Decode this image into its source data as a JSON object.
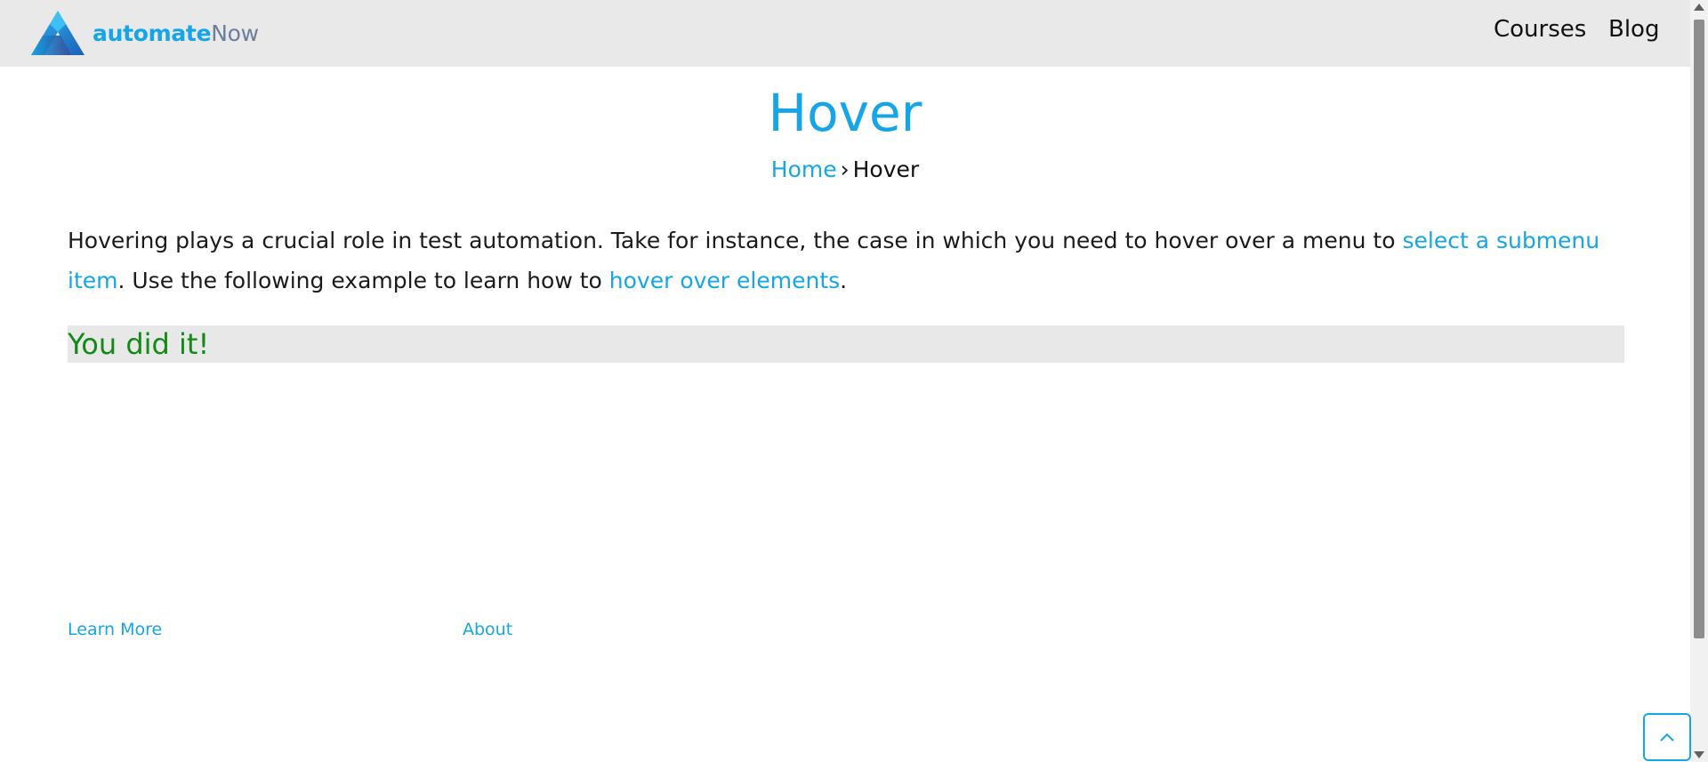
{
  "header": {
    "logo_part1": "automate",
    "logo_part2": "Now",
    "nav": {
      "courses": "Courses",
      "blog": "Blog"
    }
  },
  "page": {
    "title": "Hover",
    "breadcrumb": {
      "home": "Home",
      "separator": "›",
      "current": "Hover"
    },
    "intro": {
      "text1": "Hovering plays a crucial role in test automation. Take for instance, the case in which you need to hover over a menu to ",
      "link1": "select a submenu item",
      "text2": ". Use the following example to learn how to ",
      "link2": "hover over elements",
      "text3": "."
    },
    "result": "You did it!"
  },
  "footer": {
    "learn_more": "Learn More",
    "about": "About"
  },
  "colors": {
    "accent": "#16a5e6",
    "success": "#118a18",
    "header_bg": "#e9e9e9"
  },
  "icons": {
    "logo": "automatenow-logo",
    "back_to_top": "chevron-up-icon"
  }
}
